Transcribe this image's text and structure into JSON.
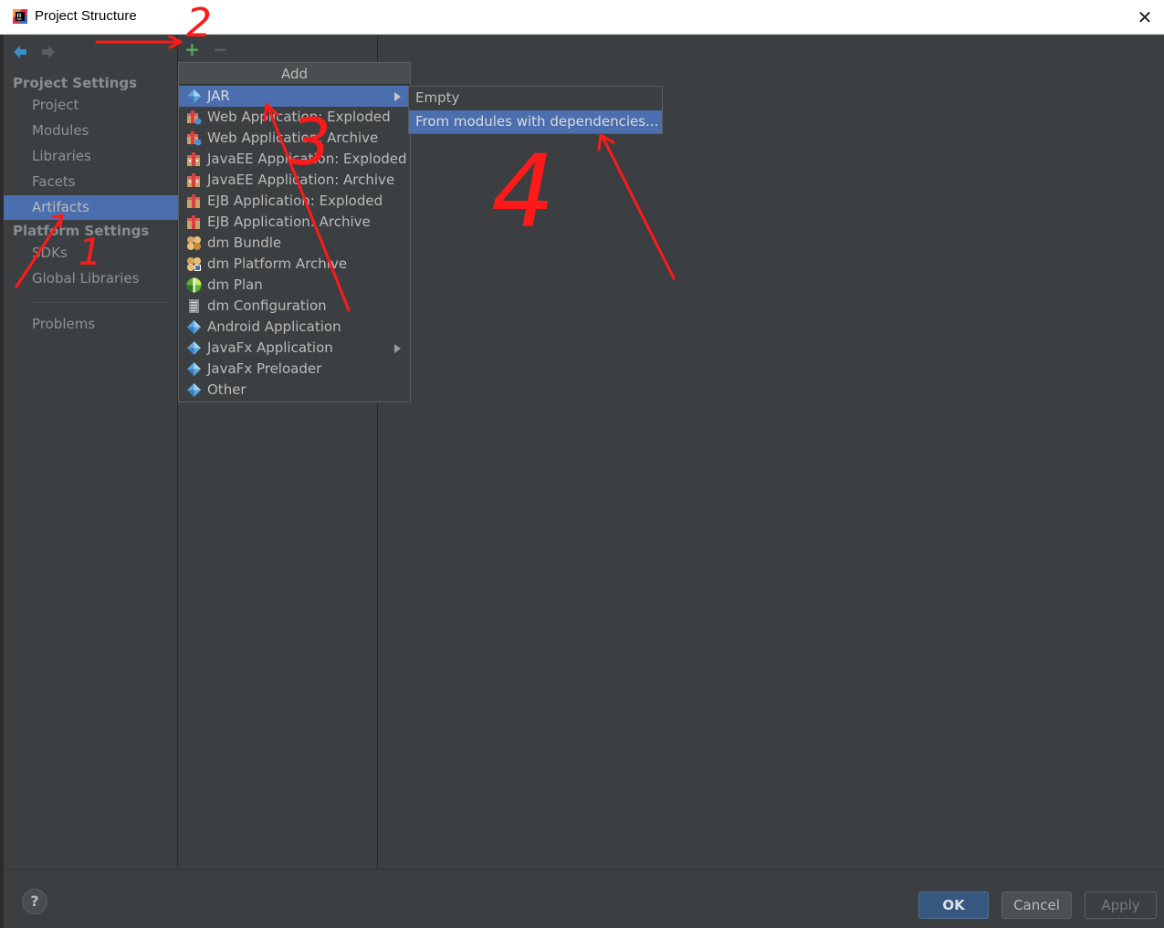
{
  "window": {
    "title": "Project Structure",
    "close_glyph": "✕"
  },
  "sidebar": {
    "project_settings_header": "Project Settings",
    "project_settings_items": [
      "Project",
      "Modules",
      "Libraries",
      "Facets",
      "Artifacts"
    ],
    "platform_settings_header": "Platform Settings",
    "platform_settings_items": [
      "SDKs",
      "Global Libraries"
    ],
    "problems": "Problems",
    "selected": "Artifacts"
  },
  "toolbar": {
    "add_glyph": "+",
    "remove_glyph": "−"
  },
  "add_popup": {
    "header": "Add",
    "items": [
      {
        "label": "JAR",
        "icon": "jar-icon",
        "submenu": true,
        "selected": true
      },
      {
        "label": "Web Application: Exploded",
        "icon": "web-app-icon"
      },
      {
        "label": "Web Application: Archive",
        "icon": "web-app-icon"
      },
      {
        "label": "JavaEE Application: Exploded",
        "icon": "javaee-app-icon"
      },
      {
        "label": "JavaEE Application: Archive",
        "icon": "javaee-app-icon"
      },
      {
        "label": "EJB Application: Exploded",
        "icon": "ejb-app-icon"
      },
      {
        "label": "EJB Application: Archive",
        "icon": "ejb-app-icon"
      },
      {
        "label": "dm Bundle",
        "icon": "dm-bundle-icon"
      },
      {
        "label": "dm Platform Archive",
        "icon": "dm-platform-icon"
      },
      {
        "label": "dm Plan",
        "icon": "dm-plan-icon"
      },
      {
        "label": "dm Configuration",
        "icon": "dm-config-icon"
      },
      {
        "label": "Android Application",
        "icon": "android-app-icon"
      },
      {
        "label": "JavaFx Application",
        "icon": "javafx-app-icon",
        "submenu": true
      },
      {
        "label": "JavaFx Preloader",
        "icon": "javafx-preloader-icon"
      },
      {
        "label": "Other",
        "icon": "other-icon"
      }
    ]
  },
  "jar_submenu": {
    "items": [
      "Empty",
      "From modules with dependencies..."
    ],
    "selected": "From modules with dependencies..."
  },
  "footer": {
    "help": "?",
    "ok": "OK",
    "cancel": "Cancel",
    "apply": "Apply"
  },
  "annotations": {
    "labels": [
      "1",
      "2",
      "3",
      "4"
    ]
  },
  "colors": {
    "background": "#3c3f41",
    "selection": "#4b6eaf",
    "accent_green": "#59a869",
    "annotation_red": "#ff1a1a"
  }
}
